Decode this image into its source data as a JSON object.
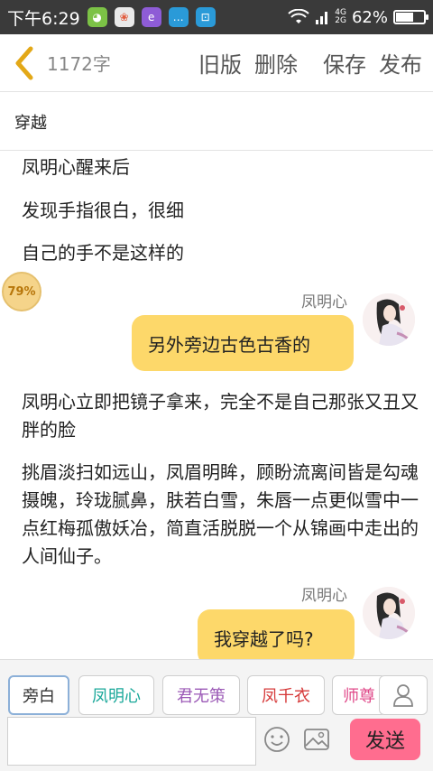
{
  "status_bar": {
    "time": "下午6:29",
    "network": [
      "4G",
      "2G"
    ],
    "battery_percent": "62%",
    "battery_level": 0.62
  },
  "header": {
    "word_count": "1172字",
    "actions": [
      "旧版",
      "删除",
      "保存",
      "发布"
    ]
  },
  "story": {
    "title": "穿越",
    "progress_badge": "79%",
    "paragraphs_top": [
      "凤明心醒来后",
      "发现手指很白，很细",
      "自己的手不是这样的"
    ],
    "dialogue_1": {
      "speaker": "凤明心",
      "text": "另外旁边古色古香的"
    },
    "paragraph_mid": "凤明心立即把镜子拿来，完全不是自己那张又丑又胖的脸",
    "paragraph_long": "挑眉淡扫如远山，凤眉明眸，顾盼流离间皆是勾魂摄魄，玲珑腻鼻，肤若白雪，朱唇一点更似雪中一点红梅孤傲妖冶，简直活脱脱一个从锦画中走出的人间仙子。",
    "dialogue_2": {
      "speaker": "凤明心",
      "text": "我穿越了吗?"
    }
  },
  "roles": [
    {
      "label": "旁白",
      "color": "#333333"
    },
    {
      "label": "凤明心",
      "color": "#1aa89a"
    },
    {
      "label": "君无策",
      "color": "#9b59b6"
    },
    {
      "label": "凤千衣",
      "color": "#d63a3a"
    },
    {
      "label": "师尊",
      "color": "#e04a8a"
    }
  ],
  "input": {
    "value": "",
    "send_label": "发送"
  },
  "icons": {
    "back": "chevron-left-icon",
    "user": "user-icon",
    "emoji": "smiley-icon",
    "image": "image-icon"
  },
  "colors": {
    "bubble": "#fdd86a",
    "send": "#ff6d8f",
    "back_arrow": "#e3a817"
  }
}
